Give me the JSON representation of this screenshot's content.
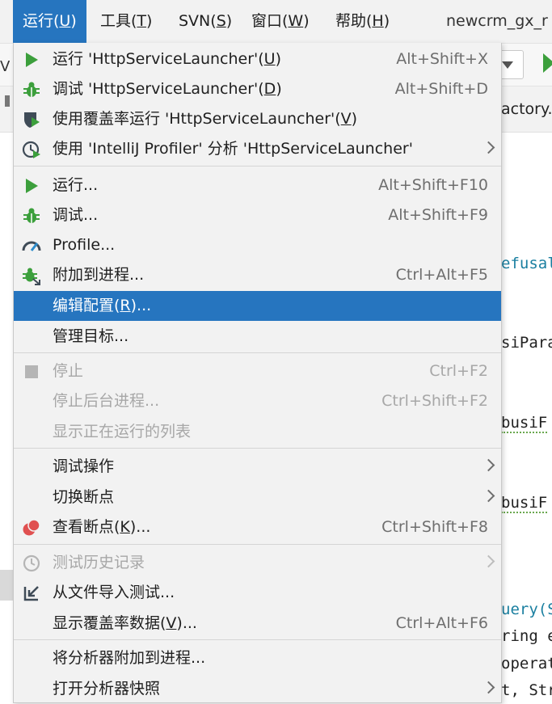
{
  "menubar": {
    "items": [
      {
        "text": "运行(",
        "mnemonic": "U",
        "suffix": ")"
      },
      {
        "text": "工具(",
        "mnemonic": "T",
        "suffix": ")"
      },
      {
        "text": "SVN(",
        "mnemonic": "S",
        "suffix": ")"
      },
      {
        "text": "窗口(",
        "mnemonic": "W",
        "suffix": ")"
      },
      {
        "text": "帮助(",
        "mnemonic": "H",
        "suffix": ")"
      }
    ],
    "project_title": "newcrm_gx_r"
  },
  "background": {
    "toolbar_left_text": "V",
    "tab_text": "actory.",
    "code_lines": [
      {
        "text": "efusal"
      },
      {
        "text": "siPara"
      },
      {
        "text": " busiF"
      },
      {
        "text": " busiF"
      },
      {
        "text": "uery(S"
      },
      {
        "text": "ring e"
      },
      {
        "text": "operat"
      },
      {
        "text": "t, Str"
      }
    ]
  },
  "menu": {
    "items": [
      {
        "pre": "运行 'HttpServiceLauncher'(",
        "mn": "U",
        "post": ")",
        "shortcut": "Alt+Shift+X"
      },
      {
        "pre": "调试 'HttpServiceLauncher'(",
        "mn": "D",
        "post": ")",
        "shortcut": "Alt+Shift+D"
      },
      {
        "pre": "使用覆盖率运行  'HttpServiceLauncher'(",
        "mn": "V",
        "post": ")",
        "shortcut": ""
      },
      {
        "pre": "使用 'IntelliJ Profiler' 分析  'HttpServiceLauncher'",
        "mn": "",
        "post": "",
        "shortcut": ""
      },
      {
        "pre": "运行...",
        "mn": "",
        "post": "",
        "shortcut": "Alt+Shift+F10"
      },
      {
        "pre": "调试...",
        "mn": "",
        "post": "",
        "shortcut": "Alt+Shift+F9"
      },
      {
        "pre": "Profile...",
        "mn": "",
        "post": "",
        "shortcut": ""
      },
      {
        "pre": "附加到进程...",
        "mn": "",
        "post": "",
        "shortcut": "Ctrl+Alt+F5"
      },
      {
        "pre": "编辑配置(",
        "mn": "R",
        "post": ")...",
        "shortcut": ""
      },
      {
        "pre": "管理目标...",
        "mn": "",
        "post": "",
        "shortcut": ""
      },
      {
        "pre": "停止",
        "mn": "",
        "post": "",
        "shortcut": "Ctrl+F2"
      },
      {
        "pre": "停止后台进程...",
        "mn": "",
        "post": "",
        "shortcut": "Ctrl+Shift+F2"
      },
      {
        "pre": "显示正在运行的列表",
        "mn": "",
        "post": "",
        "shortcut": ""
      },
      {
        "pre": "调试操作",
        "mn": "",
        "post": "",
        "shortcut": ""
      },
      {
        "pre": "切换断点",
        "mn": "",
        "post": "",
        "shortcut": ""
      },
      {
        "pre": "查看断点(",
        "mn": "K",
        "post": ")...",
        "shortcut": "Ctrl+Shift+F8"
      },
      {
        "pre": "测试历史记录",
        "mn": "",
        "post": "",
        "shortcut": ""
      },
      {
        "pre": "从文件导入测试...",
        "mn": "",
        "post": "",
        "shortcut": ""
      },
      {
        "pre": "显示覆盖率数据(",
        "mn": "V",
        "post": ")...",
        "shortcut": "Ctrl+Alt+F6"
      },
      {
        "pre": "将分析器附加到进程...",
        "mn": "",
        "post": "",
        "shortcut": ""
      },
      {
        "pre": "打开分析器快照",
        "mn": "",
        "post": "",
        "shortcut": ""
      }
    ]
  }
}
